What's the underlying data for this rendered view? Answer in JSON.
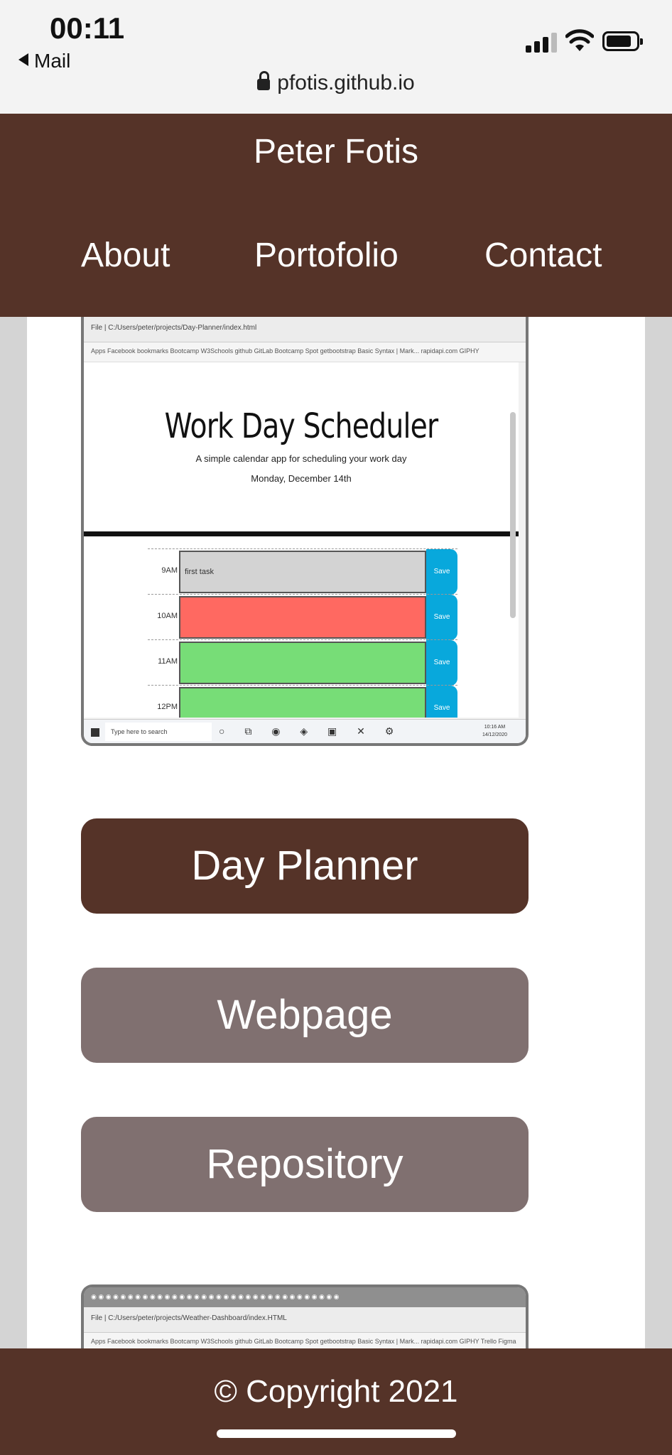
{
  "status_bar": {
    "time": "00:11",
    "back_label": "Mail",
    "url": "pfotis.github.io"
  },
  "header": {
    "title": "Peter Fotis",
    "nav": [
      "About",
      "Portofolio",
      "Contact"
    ]
  },
  "project": {
    "browser_address": "File  |  C:/Users/peter/projects/Day-Planner/index.html",
    "bookmarks": "Apps  Facebook  bookmarks  Bootcamp  W3Schools  github  GitLab  Bootcamp Spot  getbootstrap  Basic Syntax | Mark...  rapidapi.com  GIPHY",
    "app_title": "Work Day Scheduler",
    "app_subtitle": "A simple calendar app for scheduling your work day",
    "app_date": "Monday, December 14th",
    "hours": [
      {
        "label": "9AM",
        "task": "first task",
        "color": "#d3d3d3",
        "save": "Save"
      },
      {
        "label": "10AM",
        "task": "",
        "color": "#ff6961",
        "save": "Save"
      },
      {
        "label": "11AM",
        "task": "",
        "color": "#77dd77",
        "save": "Save"
      },
      {
        "label": "12PM",
        "task": "",
        "color": "#77dd77",
        "save": "Save"
      }
    ],
    "taskbar_search": "Type here to search",
    "taskbar_clock": [
      "10:16 AM",
      "14/12/2020"
    ],
    "buttons": {
      "primary": "Day Planner",
      "webpage": "Webpage",
      "repository": "Repository"
    }
  },
  "project2": {
    "browser_address": "File  |  C:/Users/peter/projects/Weather-Dashboard/index.HTML",
    "bookmarks": "Apps  Facebook  bookmarks  Bootcamp  W3Schools  github  GitLab  Bootcamp Spot  getbootstrap  Basic Syntax | Mark...  rapidapi.com  GIPHY  Trello  Figma"
  },
  "footer": {
    "copyright": "© Copyright 2021"
  },
  "colors": {
    "brand": "#553328",
    "secondary_button": "#807070",
    "save_button": "#08a8dc"
  }
}
